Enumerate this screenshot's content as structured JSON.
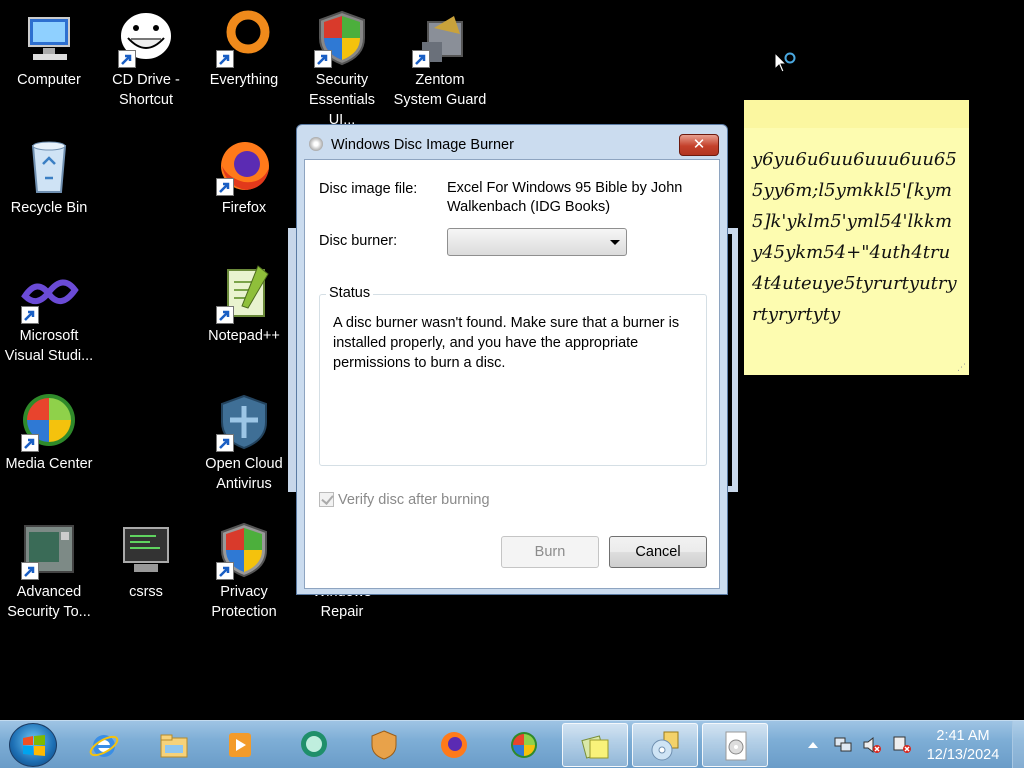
{
  "desktop": {
    "icons": [
      {
        "label": "Computer",
        "icon": "computer-icon",
        "shortcut": false
      },
      {
        "label": "CD Drive - Shortcut",
        "icon": "troll-face-icon",
        "shortcut": true
      },
      {
        "label": "Everything",
        "icon": "everything-search-icon",
        "shortcut": true
      },
      {
        "label": "Security Essentials UI...",
        "icon": "security-essentials-shield-icon",
        "shortcut": true
      },
      {
        "label": "Zentom System Guard",
        "icon": "zentom-gear-icon",
        "shortcut": true
      },
      {
        "label": "Recycle Bin",
        "icon": "recycle-bin-icon",
        "shortcut": false
      },
      {
        "label": "Firefox",
        "icon": "firefox-icon",
        "shortcut": true
      },
      {
        "label": "Microsoft Visual Studi...",
        "icon": "visual-studio-icon",
        "shortcut": true
      },
      {
        "label": "Notepad++",
        "icon": "notepad-plus-plus-icon",
        "shortcut": true
      },
      {
        "label": "Media Center",
        "icon": "media-center-icon",
        "shortcut": true
      },
      {
        "label": "Open Cloud Antivirus",
        "icon": "cloud-antivirus-shield-icon",
        "shortcut": true
      },
      {
        "label": "Advanced Security To...",
        "icon": "security-tool-icon",
        "shortcut": true
      },
      {
        "label": "csrss",
        "icon": "computer-terminal-icon",
        "shortcut": false
      },
      {
        "label": "Privacy Protection",
        "icon": "privacy-shield-icon",
        "shortcut": true
      },
      {
        "label": "Windows Repair",
        "icon": "windows-repair-icon",
        "shortcut": false
      }
    ]
  },
  "sticky_note": {
    "text": "y6yu6u6uu6uuu6uu655yy6m;l5ymkkl5'[kym5]k'yklm5'yml54'lkkmy45ykm54+\"4uth4tru4t4uteuye5tyrurtyutryrtyryrtyty"
  },
  "dialog": {
    "title": "Windows Disc Image Burner",
    "close_label": "✕",
    "disc_image_file_label": "Disc image file:",
    "disc_image_file_value": "Excel For Windows 95 Bible by John Walkenbach (IDG Books)",
    "disc_burner_label": "Disc burner:",
    "disc_burner_value": "",
    "status_label": "Status",
    "status_text": "A disc burner wasn't found. Make sure that a burner is installed properly, and you have the appropriate permissions to burn a disc.",
    "verify_label": "Verify disc after burning",
    "verify_checked": true,
    "verify_disabled": true,
    "burn_label": "Burn",
    "burn_disabled": true,
    "cancel_label": "Cancel"
  },
  "taskbar": {
    "pinned": [
      "internet-explorer-icon",
      "windows-explorer-icon",
      "media-player-icon",
      "chat-bubble-icon",
      "shield-app-icon",
      "firefox-icon",
      "media-center-icon"
    ],
    "running": [
      "sticky-notes-icon",
      "disc-burner-icon",
      "disc-image-icon"
    ],
    "clock_time": "2:41 AM",
    "clock_date": "12/13/2024"
  },
  "colors": {
    "desktop_bg": "#000000",
    "dialog_frame": "#cbdcef",
    "close_button": "#c4412b",
    "sticky_bg": "#fdfcb0",
    "taskbar": "#7eaed6"
  }
}
